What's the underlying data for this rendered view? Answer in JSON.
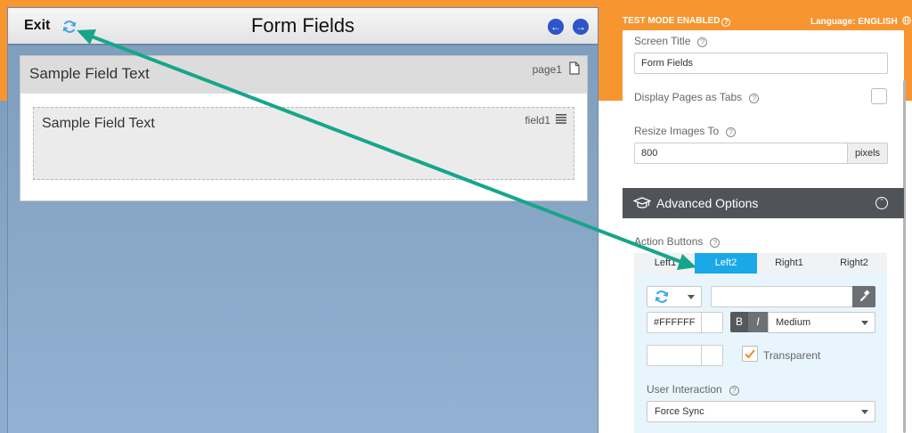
{
  "preview": {
    "exit_label": "Exit",
    "title": "Form Fields",
    "page": {
      "title": "Sample Field Text",
      "tag": "page1"
    },
    "field": {
      "text": "Sample Field Text",
      "tag": "field1"
    }
  },
  "topbar": {
    "test_mode": "TEST MODE ENABLED",
    "language": "Language: ENGLISH"
  },
  "panel": {
    "screen_title_label": "Screen Title",
    "screen_title_value": "Form Fields",
    "display_tabs_label": "Display Pages as Tabs",
    "resize_label": "Resize Images To",
    "resize_value": "800",
    "resize_unit": "pixels",
    "advanced_title": "Advanced Options",
    "action_buttons_label": "Action Buttons",
    "tabs": [
      "Left1",
      "Left2",
      "Right1",
      "Right2"
    ],
    "active_tab": "Left2",
    "color_value": "#FFFFFF",
    "bold_label": "B",
    "italic_label": "I",
    "font_size_value": "Medium",
    "transparent_label": "Transparent",
    "transparent_checked": true,
    "user_interaction_label": "User Interaction",
    "user_interaction_value": "Force Sync"
  },
  "colors": {
    "orange": "#f79530",
    "active_tab": "#1aa8e8",
    "arrow": "#17a58a",
    "nav_button": "#2c56c8",
    "dark_header": "#505459"
  },
  "icons": [
    "refresh-icon",
    "arrow-left-icon",
    "arrow-right-icon",
    "page-icon",
    "menu-icon",
    "help-icon",
    "globe-icon",
    "graduation-cap-icon",
    "chevron-up-icon",
    "hammer-icon",
    "check-icon"
  ]
}
